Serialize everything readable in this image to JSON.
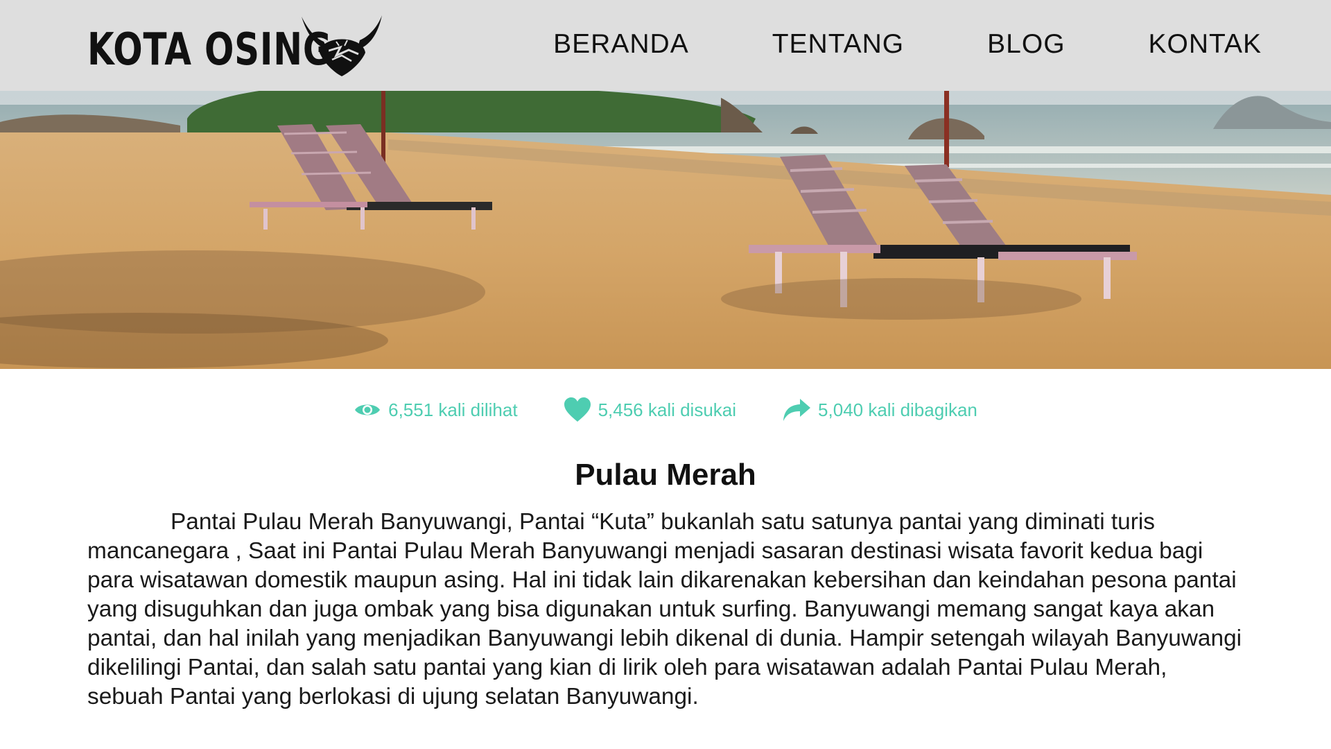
{
  "brand": {
    "name": "KOTA OSING"
  },
  "nav": {
    "items": [
      {
        "label": "BERANDA"
      },
      {
        "label": "TENTANG"
      },
      {
        "label": "BLOG"
      },
      {
        "label": "KONTAK"
      }
    ]
  },
  "hero": {
    "icon": "beach-photo"
  },
  "stats": {
    "accent_color": "#4ecdb1",
    "views": {
      "icon": "eye-icon",
      "label": "6,551 kali dilihat"
    },
    "likes": {
      "icon": "heart-icon",
      "label": "5,456 kali disukai"
    },
    "shares": {
      "icon": "share-icon",
      "label": "5,040 kali dibagikan"
    }
  },
  "article": {
    "title": "Pulau Merah",
    "body": "Pantai Pulau Merah Banyuwangi, Pantai “Kuta” bukanlah satu satunya pantai yang diminati turis mancanegara , Saat ini Pantai Pulau Merah Banyuwangi menjadi sasaran destinasi wisata favorit kedua bagi para wisatawan domestik maupun asing. Hal ini tidak lain dikarenakan kebersihan dan keindahan pesona pantai yang disuguhkan dan juga ombak yang bisa digunakan untuk surfing. Banyuwangi memang sangat kaya akan pantai, dan hal inilah yang menjadikan Banyuwangi lebih dikenal di dunia. Hampir setengah wilayah Banyuwangi dikelilingi Pantai, dan salah satu pantai yang kian di lirik oleh para wisatawan adalah Pantai Pulau Merah, sebuah Pantai yang berlokasi di ujung selatan Banyuwangi."
  }
}
